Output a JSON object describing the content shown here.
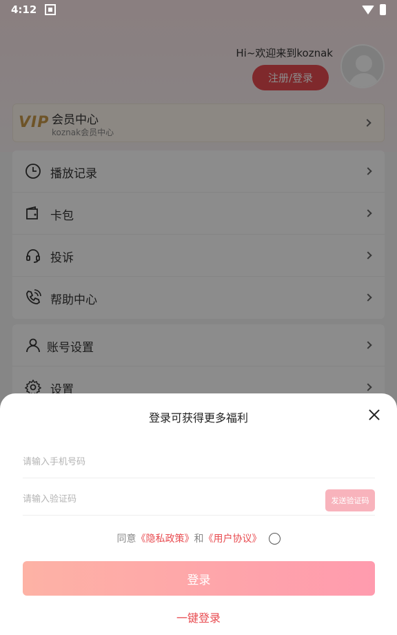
{
  "status_bar": {
    "time": "4:12"
  },
  "header": {
    "greeting": "Hi~欢迎来到koznak",
    "register_login_label": "注册/登录"
  },
  "vip": {
    "logo_text": "VIP",
    "title": "会员中心",
    "subtitle": "koznak会员中心"
  },
  "menu_group_1": [
    {
      "label": "播放记录",
      "icon": "clock-icon"
    },
    {
      "label": "卡包",
      "icon": "wallet-icon"
    },
    {
      "label": "投诉",
      "icon": "headset-icon"
    },
    {
      "label": "帮助中心",
      "icon": "phone-icon"
    }
  ],
  "menu_group_2": [
    {
      "label": "账号设置",
      "icon": "user-icon"
    },
    {
      "label": "设置",
      "icon": "gear-icon"
    }
  ],
  "login_sheet": {
    "title": "登录可获得更多福利",
    "phone_placeholder": "请输入手机号码",
    "code_placeholder": "请输入验证码",
    "send_code_label": "发送验证码",
    "agree_prefix": "同意",
    "privacy_link": "《隐私政策》",
    "agree_and": "和",
    "user_agreement_link": "《用户协议》",
    "login_label": "登录",
    "one_key_login_label": "一键登录"
  },
  "colors": {
    "accent": "#e84b50",
    "login_gradient_start": "#fdb2a5",
    "login_gradient_end": "#ff9bae",
    "send_code_bg": "#f8b3bc"
  }
}
